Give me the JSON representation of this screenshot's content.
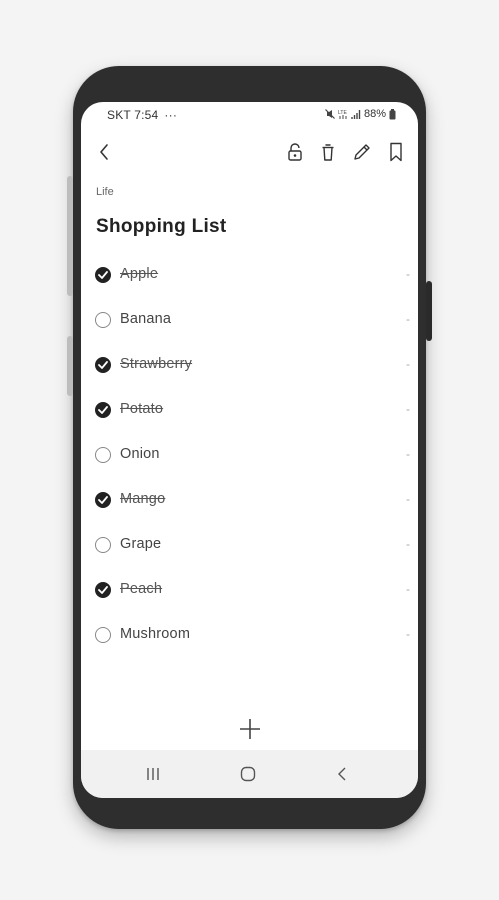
{
  "status_bar": {
    "carrier_time": "SKT 7:54",
    "more": "···",
    "battery": "88%"
  },
  "toolbar": {
    "back_icon": "chevron-left-icon",
    "lock_icon": "lock-icon",
    "trash_icon": "trash-icon",
    "edit_icon": "pencil-icon",
    "bookmark_icon": "bookmark-icon"
  },
  "note": {
    "category": "Life",
    "title": "Shopping List"
  },
  "items": [
    {
      "label": "Apple",
      "checked": true
    },
    {
      "label": "Banana",
      "checked": false
    },
    {
      "label": "Strawberry",
      "checked": true
    },
    {
      "label": "Potato",
      "checked": true
    },
    {
      "label": "Onion",
      "checked": false
    },
    {
      "label": "Mango",
      "checked": true
    },
    {
      "label": "Grape",
      "checked": false
    },
    {
      "label": "Peach",
      "checked": true
    },
    {
      "label": "Mushroom",
      "checked": false
    }
  ],
  "colors": {
    "checked": "#222222",
    "background": "#ffffff",
    "phone": "#2e2e2e"
  }
}
